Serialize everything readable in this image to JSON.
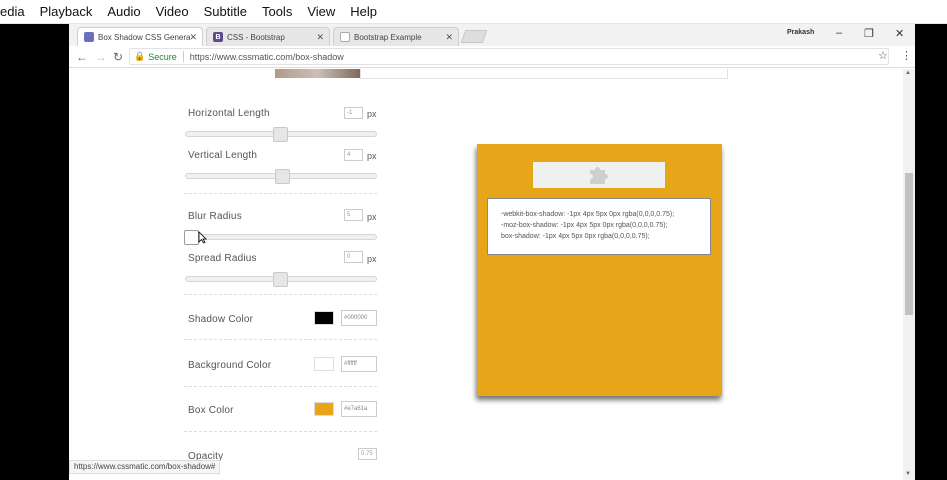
{
  "vlc_menu": [
    "edia",
    "Playback",
    "Audio",
    "Video",
    "Subtitle",
    "Tools",
    "View",
    "Help"
  ],
  "tabs": [
    {
      "label": "Box Shadow CSS Genera",
      "fav_color": "#6a6fbf",
      "fav_glyph": ""
    },
    {
      "label": "CSS - Bootstrap",
      "fav_color": "#5e4b8b",
      "fav_glyph": "B"
    },
    {
      "label": "Bootstrap Example",
      "fav_color": "#ffffff",
      "fav_glyph": ""
    }
  ],
  "profile_name": "Prakash",
  "window_controls": {
    "minimize": "–",
    "restore": "❐",
    "close": "✕"
  },
  "nav": {
    "back": "←",
    "forward": "→",
    "reload": "↻"
  },
  "omnibox": {
    "secure_label": "Secure",
    "url": "https://www.cssmatic.com/box-shadow"
  },
  "controls": {
    "horizontal": {
      "label": "Horizontal Length",
      "value": "-1",
      "unit": "px"
    },
    "vertical": {
      "label": "Vertical Length",
      "value": "4",
      "unit": "px"
    },
    "blur": {
      "label": "Blur Radius",
      "value": "5",
      "unit": "px"
    },
    "spread": {
      "label": "Spread Radius",
      "value": "0",
      "unit": "px"
    },
    "shadow_color": {
      "label": "Shadow Color",
      "value": "#000000",
      "swatch": "#000000"
    },
    "background_color": {
      "label": "Background Color",
      "value": "#ffffff",
      "swatch": "#ffffff"
    },
    "box_color": {
      "label": "Box Color",
      "value": "#e7a61a",
      "swatch": "#e7a61a"
    },
    "opacity": {
      "label": "Opacity",
      "value": "0.75"
    }
  },
  "code_lines": [
    "-webkit-box-shadow: -1px 4px 5px 0px rgba(0,0,0,0.75);",
    "-moz-box-shadow: -1px 4px 5px 0px rgba(0,0,0,0.75);",
    "box-shadow: -1px 4px 5px 0px rgba(0,0,0,0.75);"
  ],
  "status_url": "https://www.cssmatic.com/box-shadow#"
}
